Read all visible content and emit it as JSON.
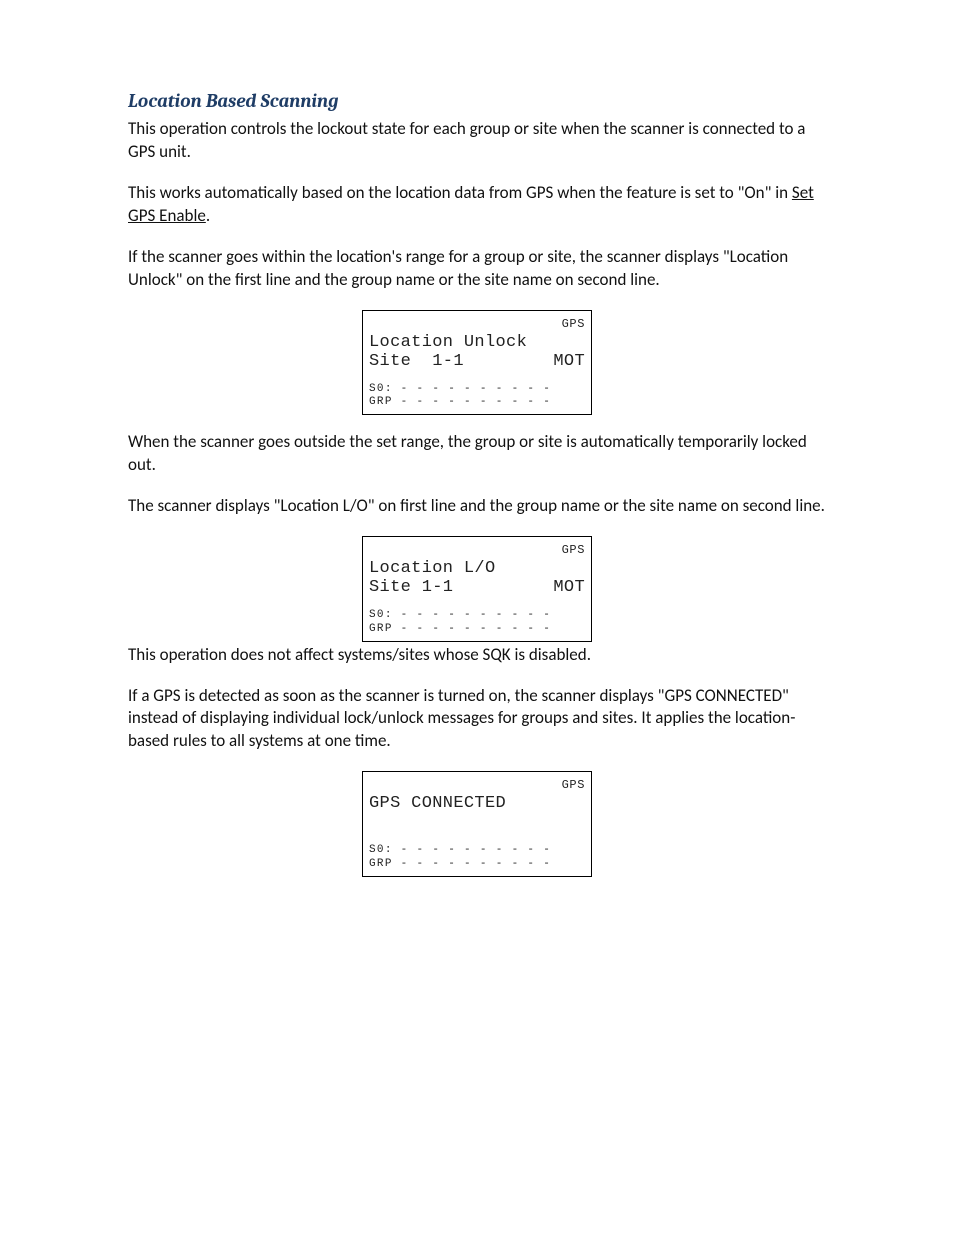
{
  "heading": "Location Based Scanning",
  "para1": "This operation controls the lockout state for each group or site when the scanner is connected to a GPS unit.",
  "para2a": "This works automatically based on the location data from GPS when the feature is set to \"On\" in ",
  "para2_link": "Set GPS Enable",
  "para2b": ".",
  "para3": "If the scanner goes within the location's range for a group or site, the scanner displays \"Location Unlock\" on the first line and the group name or the site name on second line.",
  "display1": {
    "top": "GPS",
    "line1": "Location Unlock",
    "line2_left": "Site  1-1",
    "line2_right": "MOT",
    "s0": "S0: - - - - - - - - - -",
    "grp": "GRP - - - - - - - - - -"
  },
  "para4": "When the scanner goes outside the set range, the group or site is automatically temporarily locked out.",
  "para5": "The scanner displays \"Location L/O\" on first line and the group name or the site name on second line.",
  "display2": {
    "top": "GPS",
    "line1": "Location L/O",
    "line2_left": "Site 1-1",
    "line2_right": "MOT",
    "s0": "S0: - - - - - - - - - -",
    "grp": "GRP - - - - - - - - - -"
  },
  "para6": "This operation does not affect systems/sites whose SQK is disabled.",
  "para7": "If a GPS is detected as soon as the scanner is turned on, the scanner displays \"GPS CONNECTED\" instead of displaying individual lock/unlock messages for groups and sites. It applies the location-based rules to all systems at one time.",
  "display3": {
    "top": "GPS",
    "line1": "GPS CONNECTED",
    "s0": "S0: - - - - - - - - - -",
    "grp": "GRP - - - - - - - - - -"
  }
}
